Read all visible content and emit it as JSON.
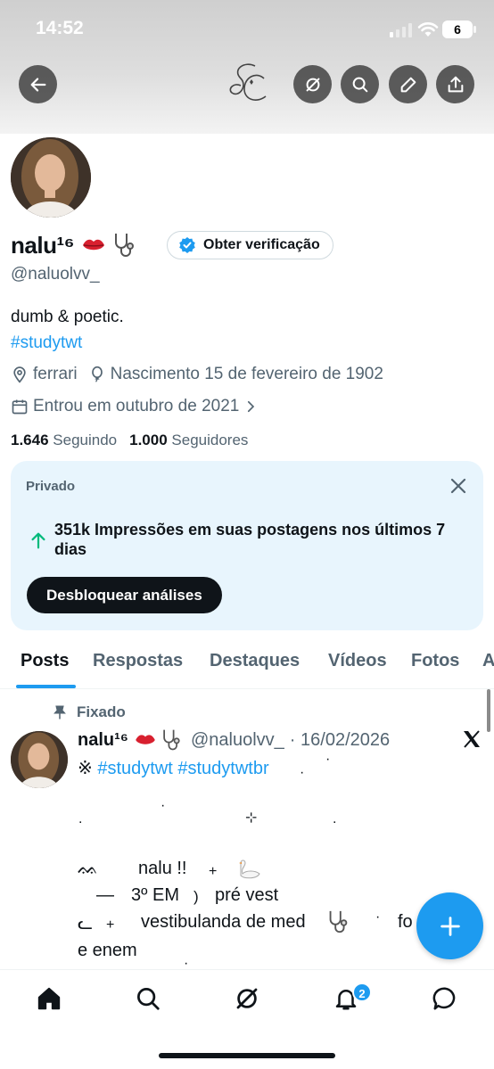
{
  "status_bar": {
    "time": "14:52",
    "battery": "6"
  },
  "profile": {
    "display_name": "nalu¹⁶",
    "verify_label": "Obter verificação",
    "handle": "@naluolvv_",
    "bio": "dumb & poetic.",
    "hashtag": "#studytwt",
    "location": "ferrari",
    "birth": "Nascimento 15 de fevereiro de 1902",
    "joined": "Entrou em outubro de 2021",
    "following_count": "1.646",
    "following_label": "Seguindo",
    "followers_count": "1.000",
    "followers_label": "Seguidores"
  },
  "analytics": {
    "private_label": "Privado",
    "impressions": "351k Impressões em suas postagens nos últimos 7 dias",
    "unlock_label": "Desbloquear análises"
  },
  "tabs": [
    {
      "label": "Posts"
    },
    {
      "label": "Respostas"
    },
    {
      "label": "Destaques"
    },
    {
      "label": "Vídeos"
    },
    {
      "label": "Fotos"
    },
    {
      "label": "A"
    }
  ],
  "post": {
    "pinned_label": "Fixado",
    "name": "nalu¹⁶",
    "handle": "@naluolvv_",
    "date": "· 16/02/2026",
    "prefix": "※",
    "hashtags": "#studytwt #studytwtbr",
    "line_name": "nalu !!",
    "line_grade_dash": "—",
    "line_grade": "3º EM",
    "line_grade_paren": ")",
    "line_prevest": "pré vest",
    "line_vest_prefix": "ᓚ",
    "line_vest": "vestibulanda de med",
    "line_fo": "fo",
    "line_enem": "e enem",
    "plus": "+",
    "sparkle": "⊹",
    "curl": "ᨐ"
  },
  "nav": {
    "notifications_badge": "2"
  },
  "colors": {
    "accent": "#1d9bf0",
    "text": "#0f1419",
    "muted": "#536471",
    "analytics_bg": "#e8f5fd"
  }
}
